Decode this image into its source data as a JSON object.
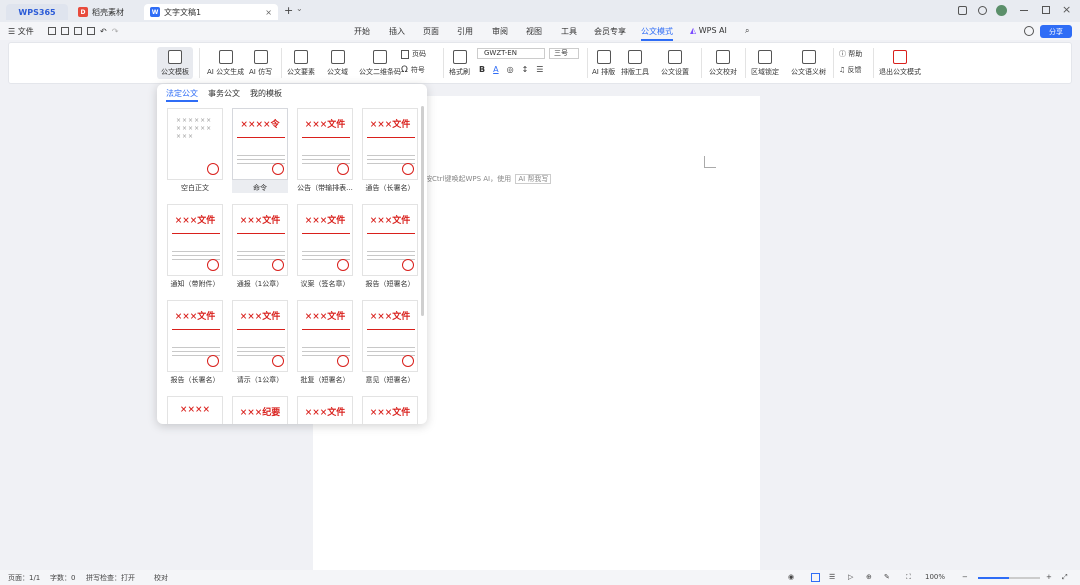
{
  "titlebar": {
    "wps_tab": "WPS365",
    "tab1": "稻壳素材",
    "tab2": "文字文稿1",
    "tab2_icon": "W",
    "tab1_icon": "D",
    "close": "×",
    "add": "+",
    "chevron": "⌄"
  },
  "menubar": {
    "file": "文件",
    "items": [
      "开始",
      "插入",
      "页面",
      "引用",
      "审阅",
      "视图",
      "工具",
      "会员专享",
      "公文模式",
      "WPS AI"
    ],
    "share": "分享",
    "active": "公文模式"
  },
  "ribbon": {
    "buttons": [
      "公文模板",
      "AI 公文生成",
      "AI 仿写",
      "公文要素",
      "公文域",
      "公文二维条码",
      "页码",
      "符号",
      "格式刷",
      "AI 排版",
      "排版工具",
      "公文设置",
      "公文校对",
      "区域锁定",
      "公文语义树",
      "帮助",
      "反馈",
      "退出公文模式"
    ],
    "font_name": "GWZT-EN",
    "font_size": "三号"
  },
  "panel": {
    "tabs": [
      "法定公文",
      "事务公文",
      "我的模板"
    ],
    "templates": [
      {
        "label": "空白正文",
        "head": ""
      },
      {
        "label": "命令",
        "head": "××××令"
      },
      {
        "label": "公告（带输排表...",
        "head": "×××文件"
      },
      {
        "label": "通告（长署名）",
        "head": "×××文件"
      },
      {
        "label": "通知（带附件）",
        "head": "×××文件"
      },
      {
        "label": "通报（1公章）",
        "head": "×××文件"
      },
      {
        "label": "议案（签名章）",
        "head": "×××文件"
      },
      {
        "label": "报告（短署名）",
        "head": "×××文件"
      },
      {
        "label": "报告（长署名）",
        "head": "×××文件"
      },
      {
        "label": "请示（1公章）",
        "head": "×××文件"
      },
      {
        "label": "批复（短署名）",
        "head": "×××文件"
      },
      {
        "label": "意见（短署名）",
        "head": "×××文件"
      },
      {
        "label": "",
        "head": "××××"
      },
      {
        "label": "",
        "head": "×××纪要"
      },
      {
        "label": "",
        "head": "×××文件"
      },
      {
        "label": "",
        "head": "×××文件"
      }
    ]
  },
  "document": {
    "hint": "按Ctrl键唤起WPS AI，使用",
    "hint_btn": "AI 帮我写"
  },
  "statusbar": {
    "page": "页面：1/1",
    "words": "字数：0",
    "spell": "拼写检查：打开",
    "proof": "校对",
    "zoom": "100%"
  }
}
